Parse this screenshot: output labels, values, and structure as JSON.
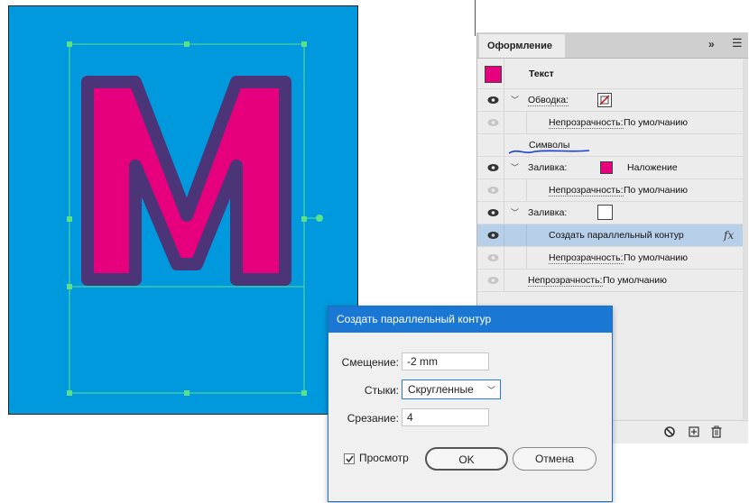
{
  "panel": {
    "tab_label": "Оформление",
    "collapse_glyph": "»",
    "menu_glyph": "☰",
    "rows": {
      "object_label": "Текст",
      "stroke_label": "Обводка:",
      "stroke_opacity_label": "Непрозрачность:",
      "stroke_opacity_value": "По умолчанию",
      "characters_label": "Символы",
      "fill1_label": "Заливка:",
      "fill1_blend": "Наложение",
      "fill1_opacity_label": "Непрозрачность:",
      "fill1_opacity_value": "По умолчанию",
      "fill2_label": "Заливка:",
      "effect_label": "Создать параллельный контур",
      "effect_fx": "fx",
      "effect_opacity_label": "Непрозрачность:",
      "effect_opacity_value": "По умолчанию",
      "object_opacity_label": "Непрозрачность:",
      "object_opacity_value": "По умолчанию"
    },
    "colors": {
      "object_swatch": "#e6007e",
      "fill_swatch": "#e6007e",
      "selected_row": "#b7cfe9"
    },
    "footer_icons": [
      "clear-appearance-icon",
      "duplicate-item-icon",
      "delete-item-icon"
    ]
  },
  "dialog": {
    "title": "Создать параллельный контур",
    "offset_label": "Смещение:",
    "offset_value": "-2 mm",
    "joins_label": "Стыки:",
    "joins_value": "Скругленные",
    "miter_label": "Срезание:",
    "miter_value": "4",
    "preview_label": "Просмотр",
    "preview_checked": true,
    "ok_label": "OK",
    "cancel_label": "Отмена"
  },
  "canvas": {
    "artboard_color": "#0099dd",
    "letter": "M",
    "letter_fill": "#e6007e",
    "letter_stroke": "#4b3478",
    "selection_color": "#5ce08a",
    "annotation_color": "#1a3fd1"
  }
}
